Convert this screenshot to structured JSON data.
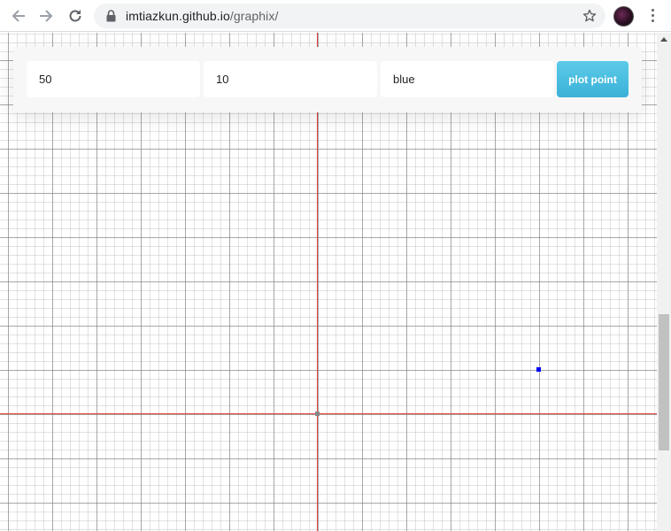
{
  "browser": {
    "url_host": "imtiazkun.github.io",
    "url_path": "/graphix/",
    "icons": [
      "back-arrow-icon",
      "forward-arrow-icon",
      "reload-icon",
      "lock-icon",
      "star-icon",
      "profile-avatar",
      "kebab-menu-icon"
    ]
  },
  "form": {
    "x_value": "50",
    "y_value": "10",
    "color_value": "blue",
    "button_label": "plot point"
  },
  "graph": {
    "axis_color": "#e8413b",
    "plotted_point": {
      "x": 50,
      "y": 10,
      "color": "blue"
    },
    "grid": true
  },
  "colors": {
    "accent_button": "#3ab1d8"
  }
}
